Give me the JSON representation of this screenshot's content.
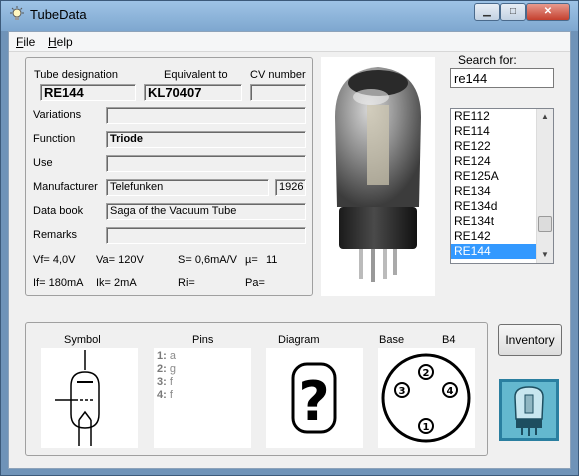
{
  "window": {
    "title": "TubeData",
    "min_glyph": "▁",
    "max_glyph": "□",
    "close_glyph": "✕"
  },
  "menu": {
    "file_underline": "F",
    "file_rest": "ile",
    "help_underline": "H",
    "help_rest": "elp"
  },
  "header_labels": {
    "designation": "Tube designation",
    "equivalent": "Equivalent to",
    "cv": "CV number"
  },
  "fields": {
    "designation": "RE144",
    "equivalent": "KL70407",
    "cv": "",
    "variations_label": "Variations",
    "variations": "",
    "function_label": "Function",
    "function": "Triode",
    "use_label": "Use",
    "use": "",
    "manufacturer_label": "Manufacturer",
    "manufacturer": "Telefunken",
    "year": "1926",
    "databook_label": "Data book",
    "databook": "Saga of the Vacuum Tube",
    "remarks_label": "Remarks",
    "remarks": ""
  },
  "specs": {
    "vf": "Vf= 4,0V",
    "va": "Va=  120V",
    "s": "S= 0,6mA/V",
    "mu": "µ=",
    "mu_val": "11",
    "if": "If= 180mA",
    "ik": "Ik=   2mA",
    "ri": "Ri=",
    "pa": "Pa="
  },
  "search": {
    "label": "Search for:",
    "value": "re144"
  },
  "tube_list": {
    "items": [
      "RE112",
      "RE114",
      "RE122",
      "RE124",
      "RE125A",
      "RE134",
      "RE134d",
      "RE134t",
      "RE142",
      "RE144"
    ],
    "selected": "RE144",
    "up_glyph": "▲",
    "down_glyph": "▼"
  },
  "bottom": {
    "symbol": "Symbol",
    "pins": "Pins",
    "diagram": "Diagram",
    "base": "Base",
    "base_type": "B4",
    "pins_list": [
      {
        "num": "1:",
        "name": "a"
      },
      {
        "num": "2:",
        "name": "g"
      },
      {
        "num": "3:",
        "name": "f"
      },
      {
        "num": "4:",
        "name": "f"
      }
    ],
    "diagram_glyph": "?",
    "base_pin_numbers": [
      "1",
      "2",
      "3",
      "4"
    ]
  },
  "buttons": {
    "inventory": "Inventory"
  },
  "colors": {
    "selection": "#3399ff",
    "title_bar": "#8db4dc",
    "panel_bg": "#f0f0f0"
  },
  "icons": [
    "lightbulb-icon",
    "minimize-icon",
    "maximize-icon",
    "close-icon",
    "vacuum-tube-photo",
    "tube-symbol-icon",
    "question-mark-icon",
    "base-socket-icon",
    "logo-icon"
  ]
}
